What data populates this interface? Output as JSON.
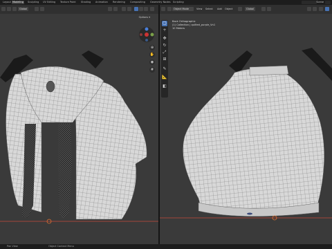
{
  "topbar": {
    "tabs": [
      {
        "label": "Layout",
        "active": false
      },
      {
        "label": "Modeling",
        "active": true
      },
      {
        "label": "Sculpting",
        "active": false
      },
      {
        "label": "UV Editing",
        "active": false
      },
      {
        "label": "Texture Paint",
        "active": false
      },
      {
        "label": "Shading",
        "active": false
      },
      {
        "label": "Animation",
        "active": false
      },
      {
        "label": "Rendering",
        "active": false
      },
      {
        "label": "Compositing",
        "active": false
      },
      {
        "label": "Geometry Nodes",
        "active": false
      },
      {
        "label": "Scripting",
        "active": false
      }
    ],
    "scene_label": "Scene"
  },
  "left_viewport": {
    "header": {
      "orientation": "Global",
      "options_label": "Options ▾"
    }
  },
  "right_viewport": {
    "header": {
      "mode": "Object Mode",
      "menus": [
        "View",
        "Select",
        "Add",
        "Object"
      ],
      "orientation": "Global"
    },
    "info": {
      "line1": "Back Orthographic",
      "line2": "(1) Collection | quilted_purple_Vn1",
      "line3": "10 Meters"
    }
  },
  "status": {
    "left": "Pan View",
    "right": "Object Context Menu"
  },
  "colors": {
    "accent": "#4772b3",
    "viewport_bg": "#3a3a3a",
    "mesh": "#d9d9d9",
    "wire": "#6b6b6b",
    "ground_line": "#c84a3a"
  },
  "icons": [
    "cursor-icon",
    "move-icon",
    "rotate-icon",
    "scale-icon",
    "transform-icon",
    "annotate-icon",
    "measure-icon",
    "add-cube-icon",
    "zoom-icon",
    "hand-icon",
    "camera-icon",
    "grid-icon"
  ]
}
